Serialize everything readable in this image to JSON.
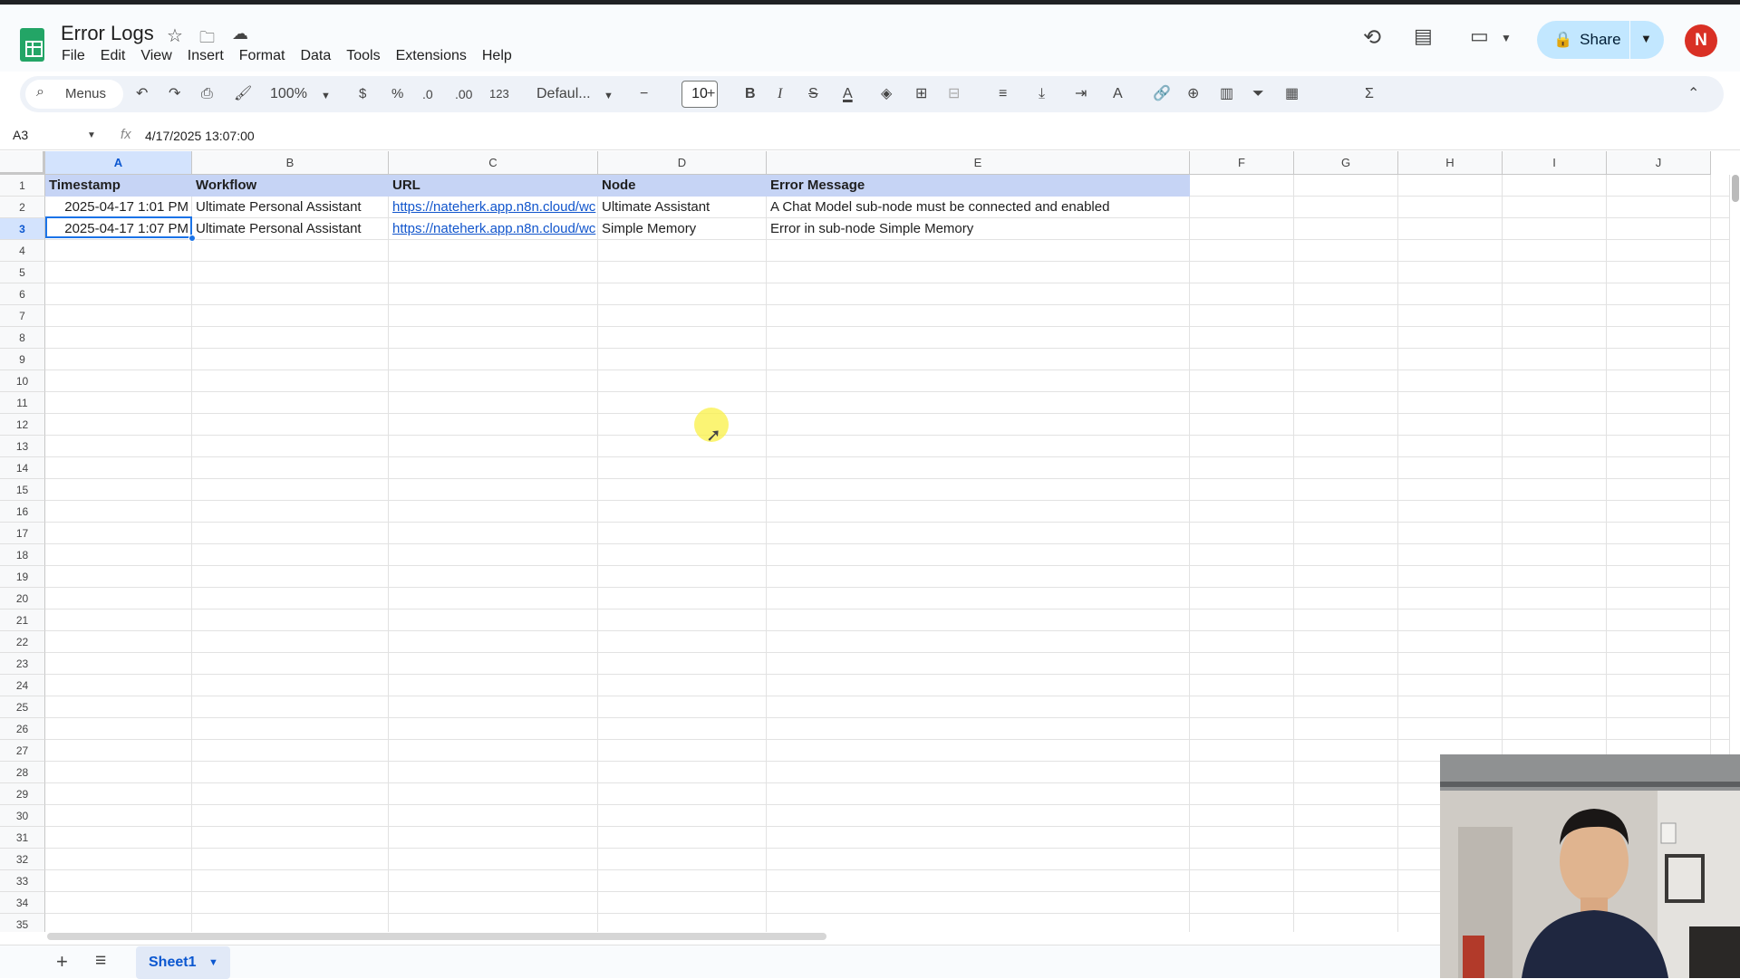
{
  "doc": {
    "title": "Error Logs"
  },
  "menu": [
    "File",
    "Edit",
    "View",
    "Insert",
    "Format",
    "Data",
    "Tools",
    "Extensions",
    "Help"
  ],
  "share_label": "Share",
  "avatar_letter": "N",
  "toolbar": {
    "menus_label": "Menus",
    "zoom": "100%",
    "currency": "$",
    "percent": "%",
    "dec_decrease": ".0",
    "dec_increase": ".00",
    "number_format": "123",
    "font": "Defaul...",
    "font_size": "10"
  },
  "formula_bar": {
    "cell_ref": "A3",
    "fx": "fx",
    "value": "4/17/2025 13:07:00"
  },
  "columns": [
    {
      "label": "A",
      "selected": true
    },
    {
      "label": "B",
      "selected": false
    },
    {
      "label": "C",
      "selected": false
    },
    {
      "label": "D",
      "selected": false
    },
    {
      "label": "E",
      "selected": false
    },
    {
      "label": "F",
      "selected": false
    },
    {
      "label": "G",
      "selected": false
    },
    {
      "label": "H",
      "selected": false
    },
    {
      "label": "I",
      "selected": false
    },
    {
      "label": "J",
      "selected": false
    }
  ],
  "row_numbers": [
    "1",
    "2",
    "3",
    "4",
    "5",
    "6",
    "7",
    "8",
    "9",
    "10",
    "11",
    "12",
    "13",
    "14",
    "15",
    "16",
    "17",
    "18",
    "19",
    "20",
    "21",
    "22",
    "23",
    "24",
    "25",
    "26",
    "27",
    "28",
    "29",
    "30",
    "31",
    "32",
    "33",
    "34",
    "35"
  ],
  "selected_row": "3",
  "table": {
    "header": [
      "Timestamp",
      "Workflow",
      "URL",
      "Node",
      "Error Message"
    ],
    "rows": [
      [
        "2025-04-17 1:01 PM",
        "Ultimate Personal Assistant",
        "https://nateherk.app.n8n.cloud/wc",
        "Ultimate Assistant",
        "A Chat Model sub-node must be connected and enabled"
      ],
      [
        "2025-04-17 1:07 PM",
        "Ultimate Personal Assistant",
        "https://nateherk.app.n8n.cloud/wc",
        "Simple Memory",
        "Error in sub-node Simple Memory"
      ]
    ]
  },
  "sheet_tab": "Sheet1",
  "colors": {
    "header_fill": "#c6d4f5",
    "selection": "#1a73e8",
    "link": "#1155cc",
    "share_bg": "#c2e7ff",
    "avatar": "#d93025",
    "sheets_green": "#23a566"
  }
}
